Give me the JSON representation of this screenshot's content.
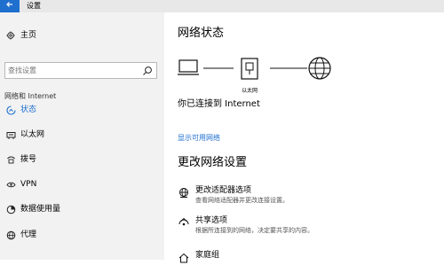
{
  "window": {
    "title": "设置"
  },
  "sidebar": {
    "home_label": "主页",
    "search_placeholder": "查找设置",
    "section_label": "网络和 Internet",
    "items": [
      {
        "label": "状态",
        "icon": "home-status-icon",
        "active": true
      },
      {
        "label": "以太网",
        "icon": "ethernet-icon",
        "active": false
      },
      {
        "label": "拨号",
        "icon": "dialup-icon",
        "active": false
      },
      {
        "label": "VPN",
        "icon": "vpn-icon",
        "active": false
      },
      {
        "label": "数据使用量",
        "icon": "data-usage-icon",
        "active": false
      },
      {
        "label": "代理",
        "icon": "globe-icon",
        "active": false
      }
    ]
  },
  "main": {
    "network_status_heading": "网络状态",
    "adapter_label": "以太网",
    "connected_text": "你已连接到 Internet",
    "show_networks_link": "显示可用网络",
    "change_settings_heading": "更改网络设置",
    "options": [
      {
        "title": "更改适配器选项",
        "desc": "查看网络适配器并更改连接设置。",
        "icon": "adapter-options-icon"
      },
      {
        "title": "共享选项",
        "desc": "根据所连接到的网络，决定要共享的内容。",
        "icon": "sharing-icon"
      },
      {
        "title": "家庭组",
        "desc": "",
        "icon": "homegroup-icon"
      }
    ]
  },
  "colors": {
    "accent": "#1f6fcf",
    "sidebar_bg": "#f2f2f2"
  }
}
